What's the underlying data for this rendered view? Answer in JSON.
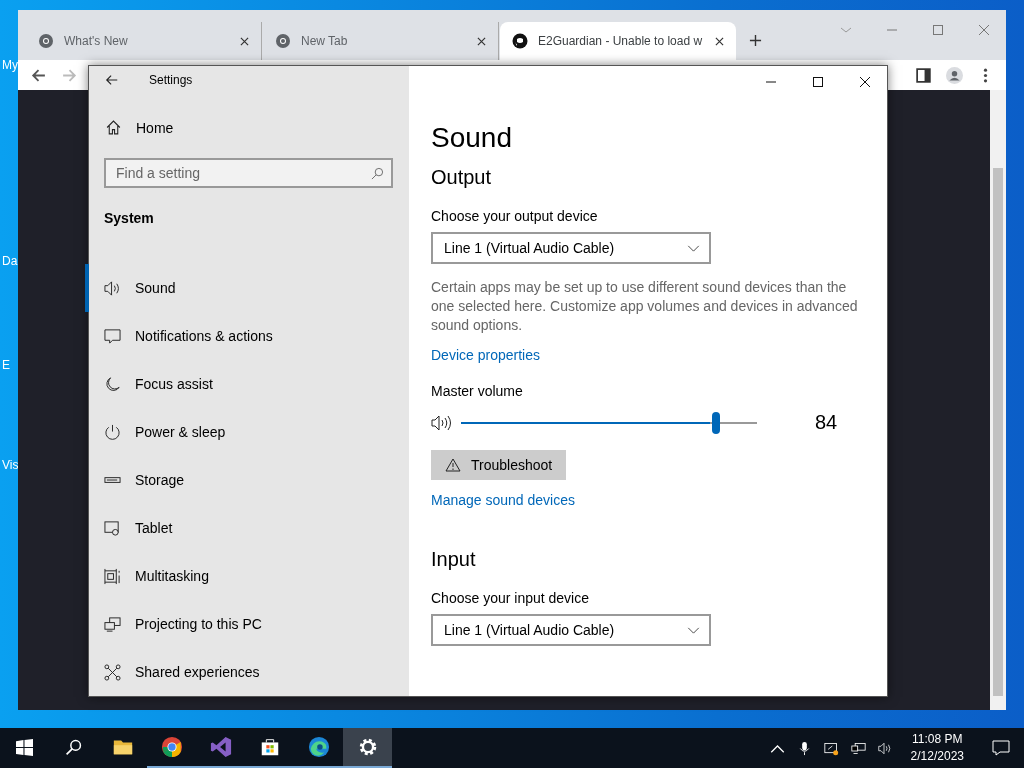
{
  "desktop": {
    "icon_labels": [
      "My",
      "Da",
      "E",
      "Vis"
    ]
  },
  "browser": {
    "tabs": [
      {
        "title": "What's New",
        "kind": "chrome",
        "selected": false
      },
      {
        "title": "New Tab",
        "kind": "chrome",
        "selected": false
      },
      {
        "title": "E2Guardian - Unable to load w",
        "kind": "github",
        "selected": true
      }
    ]
  },
  "settings": {
    "title": "Settings",
    "nav": {
      "home": "Home",
      "search_placeholder": "Find a setting",
      "section": "System",
      "items": [
        {
          "label": "Sound",
          "kind": "speaker",
          "selected": true
        },
        {
          "label": "Notifications & actions",
          "kind": "message",
          "selected": false
        },
        {
          "label": "Focus assist",
          "kind": "moon",
          "selected": false
        },
        {
          "label": "Power & sleep",
          "kind": "power",
          "selected": false
        },
        {
          "label": "Storage",
          "kind": "drive",
          "selected": false
        },
        {
          "label": "Tablet",
          "kind": "tablet",
          "selected": false
        },
        {
          "label": "Multitasking",
          "kind": "multitask",
          "selected": false
        },
        {
          "label": "Projecting to this PC",
          "kind": "project",
          "selected": false
        },
        {
          "label": "Shared experiences",
          "kind": "share",
          "selected": false
        }
      ]
    },
    "page": {
      "title": "Sound",
      "output": {
        "heading": "Output",
        "device_label": "Choose your output device",
        "device": "Line 1 (Virtual Audio Cable)",
        "note": "Certain apps may be set up to use different sound devices than the one selected here. Customize app volumes and devices in advanced sound options.",
        "device_properties_link": "Device properties",
        "volume_label": "Master volume",
        "volume": {
          "level": 0.84,
          "reading": "84"
        },
        "troubleshoot": "Troubleshoot",
        "manage_link": "Manage sound devices"
      },
      "input": {
        "heading": "Input",
        "device_label": "Choose your input device",
        "device": "Line 1 (Virtual Audio Cable)"
      }
    }
  },
  "taskbar": {
    "apps": [
      {
        "kind": "folder",
        "running": false,
        "selected": false
      },
      {
        "kind": "chrome",
        "running": true,
        "selected": false
      },
      {
        "kind": "studio",
        "running": true,
        "selected": false
      },
      {
        "kind": "store",
        "running": true,
        "selected": false
      },
      {
        "kind": "edge",
        "running": true,
        "selected": false
      },
      {
        "kind": "gear",
        "running": true,
        "selected": true
      }
    ],
    "clock": {
      "time": "11:08 PM",
      "date": "2/12/2023"
    }
  }
}
